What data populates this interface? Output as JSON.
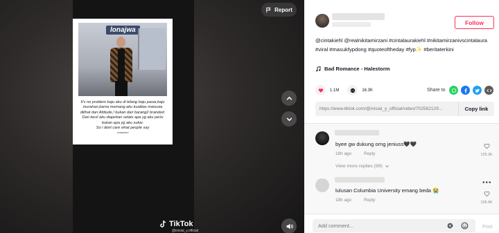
{
  "video": {
    "report_label": "Report",
    "card_sign_text": "lonajwa",
    "quote_lines": [
      "It's no problem baju aku di bilang baju pasar,baju",
      "murahan,karna memang aku kualitas manusia",
      "dilihat dari Attitude,! bukan dari barang2 branded.",
      "Dari kecil aku diajarkan selalu apa yg aku perlu",
      "bukan apa yg aku sukai.",
      "So i dont care what people say"
    ],
    "quote_signature": "cintakiehl",
    "watermark_text": "TikTok",
    "watermark_sub": "@inisial_y.official"
  },
  "info": {
    "follow_label": "Follow",
    "description": "@cintakiehl @realnikitamirzani #cintalaurakiehl #nikitamirzanivscintalaura #viral #masukfypdong #quoteoftheday #fyp✨ #beritaterkini",
    "music": "Bad Romance - Halestorm",
    "likes": "1.1M",
    "comments_count": "16.3K",
    "share_label": "Share to",
    "share_link": "https://www.tiktok.com/@inisial_y_official/video/702582129...",
    "copy_label": "Copy link"
  },
  "comments": [
    {
      "text": "byee gw dukung orng jeniuss🖤🖤",
      "time": "18h ago",
      "reply": "Reply",
      "likes": "125.3K"
    },
    {
      "text": "lulusan Columbia University emang beda 😭",
      "time": "18h ago",
      "reply": "Reply",
      "likes": "106.9K"
    }
  ],
  "view_replies": "View more replies (99)",
  "composer": {
    "placeholder": "Add comment...",
    "post_label": "Post"
  },
  "colors": {
    "accent": "#fe2c55",
    "muted": "#8a8b91"
  }
}
